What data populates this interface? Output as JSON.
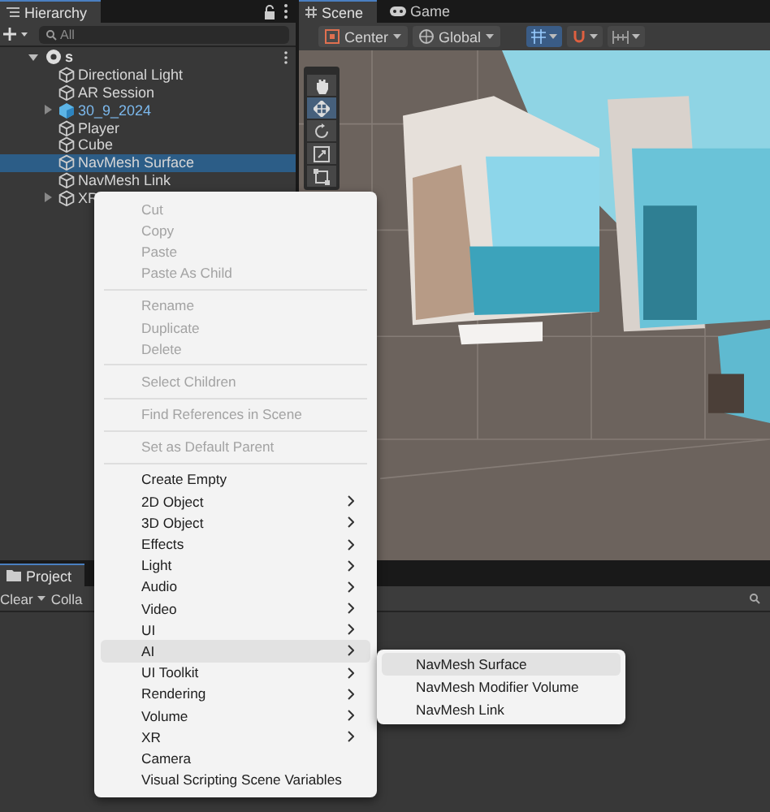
{
  "hierarchy": {
    "tab": "Hierarchy",
    "search": {
      "placeholder": "All"
    },
    "scene": {
      "name": "s",
      "expanded": true,
      "children": [
        {
          "name": "Directional Light",
          "kind": "object",
          "collapsed": false,
          "selected": false
        },
        {
          "name": "AR Session",
          "kind": "object",
          "collapsed": false,
          "selected": false
        },
        {
          "name": "30_9_2024",
          "kind": "prefab",
          "collapsed": true,
          "selected": false
        },
        {
          "name": "Player",
          "kind": "object",
          "collapsed": false,
          "selected": false
        },
        {
          "name": "Cube",
          "kind": "object",
          "collapsed": false,
          "selected": false
        },
        {
          "name": "NavMesh Surface",
          "kind": "object",
          "collapsed": false,
          "selected": true
        },
        {
          "name": "NavMesh Link",
          "kind": "object",
          "collapsed": false,
          "selected": false
        },
        {
          "name": "XR",
          "kind": "object",
          "collapsed": true,
          "selected": false
        }
      ]
    }
  },
  "scene_view": {
    "tabs": [
      {
        "label": "Scene",
        "kind": "scene",
        "selected": true
      },
      {
        "label": "Game",
        "kind": "game",
        "selected": false
      }
    ],
    "toolbar": [
      {
        "label": "Center",
        "kind": "pivot"
      },
      {
        "label": "Global",
        "kind": "global"
      }
    ],
    "tools": [
      {
        "kind": "hand",
        "selected": false
      },
      {
        "kind": "move",
        "selected": true
      },
      {
        "kind": "rotate",
        "selected": false
      },
      {
        "kind": "scale",
        "selected": false
      },
      {
        "kind": "rect",
        "selected": false
      }
    ]
  },
  "bottom_panel": {
    "tab": "Project",
    "clear": "Clear",
    "collapse": "Colla"
  },
  "context_menu": {
    "items": [
      {
        "kind": "item",
        "label": "Cut",
        "disabled": true,
        "submenu": false,
        "selected": false
      },
      {
        "kind": "item",
        "label": "Copy",
        "disabled": true,
        "submenu": false,
        "selected": false
      },
      {
        "kind": "item",
        "label": "Paste",
        "disabled": true,
        "submenu": false,
        "selected": false
      },
      {
        "kind": "item",
        "label": "Paste As Child",
        "disabled": true,
        "submenu": false,
        "selected": false
      },
      {
        "kind": "separator"
      },
      {
        "kind": "item",
        "label": "Rename",
        "disabled": true,
        "submenu": false,
        "selected": false
      },
      {
        "kind": "item",
        "label": "Duplicate",
        "disabled": true,
        "submenu": false,
        "selected": false
      },
      {
        "kind": "item",
        "label": "Delete",
        "disabled": true,
        "submenu": false,
        "selected": false
      },
      {
        "kind": "separator"
      },
      {
        "kind": "item",
        "label": "Select Children",
        "disabled": true,
        "submenu": false,
        "selected": false
      },
      {
        "kind": "separator"
      },
      {
        "kind": "item",
        "label": "Find References in Scene",
        "disabled": true,
        "submenu": false,
        "selected": false
      },
      {
        "kind": "separator"
      },
      {
        "kind": "item",
        "label": "Set as Default Parent",
        "disabled": true,
        "submenu": false,
        "selected": false
      },
      {
        "kind": "separator"
      },
      {
        "kind": "item",
        "label": "Create Empty",
        "disabled": false,
        "submenu": false,
        "selected": false
      },
      {
        "kind": "item",
        "label": "2D Object",
        "disabled": false,
        "submenu": true,
        "selected": false
      },
      {
        "kind": "item",
        "label": "3D Object",
        "disabled": false,
        "submenu": true,
        "selected": false
      },
      {
        "kind": "item",
        "label": "Effects",
        "disabled": false,
        "submenu": true,
        "selected": false
      },
      {
        "kind": "item",
        "label": "Light",
        "disabled": false,
        "submenu": true,
        "selected": false
      },
      {
        "kind": "item",
        "label": "Audio",
        "disabled": false,
        "submenu": true,
        "selected": false
      },
      {
        "kind": "item",
        "label": "Video",
        "disabled": false,
        "submenu": true,
        "selected": false
      },
      {
        "kind": "item",
        "label": "UI",
        "disabled": false,
        "submenu": true,
        "selected": false
      },
      {
        "kind": "item",
        "label": "AI",
        "disabled": false,
        "submenu": true,
        "selected": true
      },
      {
        "kind": "item",
        "label": "UI Toolkit",
        "disabled": false,
        "submenu": true,
        "selected": false
      },
      {
        "kind": "item",
        "label": "Rendering",
        "disabled": false,
        "submenu": true,
        "selected": false
      },
      {
        "kind": "item",
        "label": "Volume",
        "disabled": false,
        "submenu": true,
        "selected": false
      },
      {
        "kind": "item",
        "label": "XR",
        "disabled": false,
        "submenu": true,
        "selected": false
      },
      {
        "kind": "item",
        "label": "Camera",
        "disabled": false,
        "submenu": false,
        "selected": false
      },
      {
        "kind": "item",
        "label": "Visual Scripting Scene Variables",
        "disabled": false,
        "submenu": false,
        "selected": false
      }
    ]
  },
  "submenu": {
    "items": [
      {
        "label": "NavMesh Surface",
        "selected": true
      },
      {
        "label": "NavMesh Modifier Volume",
        "selected": false
      },
      {
        "label": "NavMesh Link",
        "selected": false
      }
    ]
  }
}
